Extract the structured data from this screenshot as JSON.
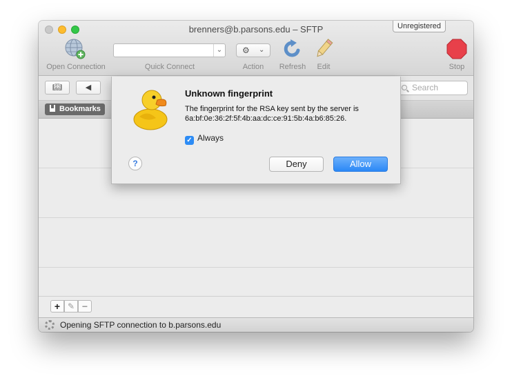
{
  "window": {
    "title": "brenners@b.parsons.edu – SFTP",
    "unregistered_label": "Unregistered"
  },
  "toolbar": {
    "open_connection_label": "Open Connection",
    "quick_connect_label": "Quick Connect",
    "quick_connect_value": "",
    "action_label": "Action",
    "refresh_label": "Refresh",
    "edit_label": "Edit",
    "stop_label": "Stop"
  },
  "search": {
    "placeholder": "Search"
  },
  "tabs": {
    "bookmarks_label": "Bookmarks"
  },
  "bottom": {
    "add_label": "+",
    "edit_label": "✎",
    "remove_label": "−"
  },
  "status": {
    "text": "Opening SFTP connection to b.parsons.edu"
  },
  "dialog": {
    "title": "Unknown fingerprint",
    "message": "The fingerprint for the RSA key sent by the server is 6a:bf:0e:36:2f:5f:4b:aa:dc:ce:91:5b:4a:b6:85:26.",
    "always_label": "Always",
    "always_checked": true,
    "help_label": "?",
    "deny_label": "Deny",
    "allow_label": "Allow"
  },
  "colors": {
    "accent": "#2b88f6",
    "stop_red": "#e8404a",
    "duck_yellow": "#f5c518"
  }
}
